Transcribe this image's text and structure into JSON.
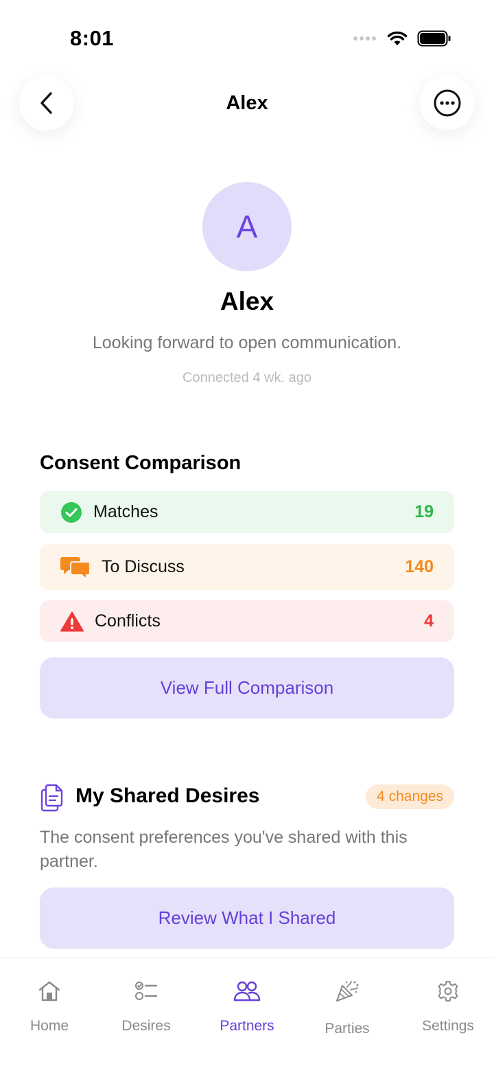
{
  "status_bar": {
    "time": "8:01"
  },
  "header": {
    "title": "Alex"
  },
  "profile": {
    "initial": "A",
    "name": "Alex",
    "bio": "Looking forward to open communication.",
    "connected": "Connected 4 wk. ago"
  },
  "consent": {
    "title": "Consent Comparison",
    "rows": [
      {
        "label": "Matches",
        "count": "19",
        "icon": "check-circle-icon",
        "color": "#2fb54a"
      },
      {
        "label": "To Discuss",
        "count": "140",
        "icon": "chat-bubbles-icon",
        "color": "#f28a22"
      },
      {
        "label": "Conflicts",
        "count": "4",
        "icon": "warning-triangle-icon",
        "color": "#ef3939"
      }
    ],
    "button_label": "View Full Comparison"
  },
  "shared": {
    "title": "My Shared Desires",
    "badge": "4 changes",
    "description": "The consent preferences you've shared with this partner.",
    "button_label": "Review What I Shared"
  },
  "tabs": [
    {
      "label": "Home",
      "icon": "home-icon",
      "active": false
    },
    {
      "label": "Desires",
      "icon": "checklist-icon",
      "active": false
    },
    {
      "label": "Partners",
      "icon": "people-icon",
      "active": true
    },
    {
      "label": "Parties",
      "icon": "party-popper-icon",
      "active": false
    },
    {
      "label": "Settings",
      "icon": "gear-icon",
      "active": false
    }
  ],
  "colors": {
    "accent": "#6540d8",
    "avatar_bg": "#e2dcfb"
  }
}
